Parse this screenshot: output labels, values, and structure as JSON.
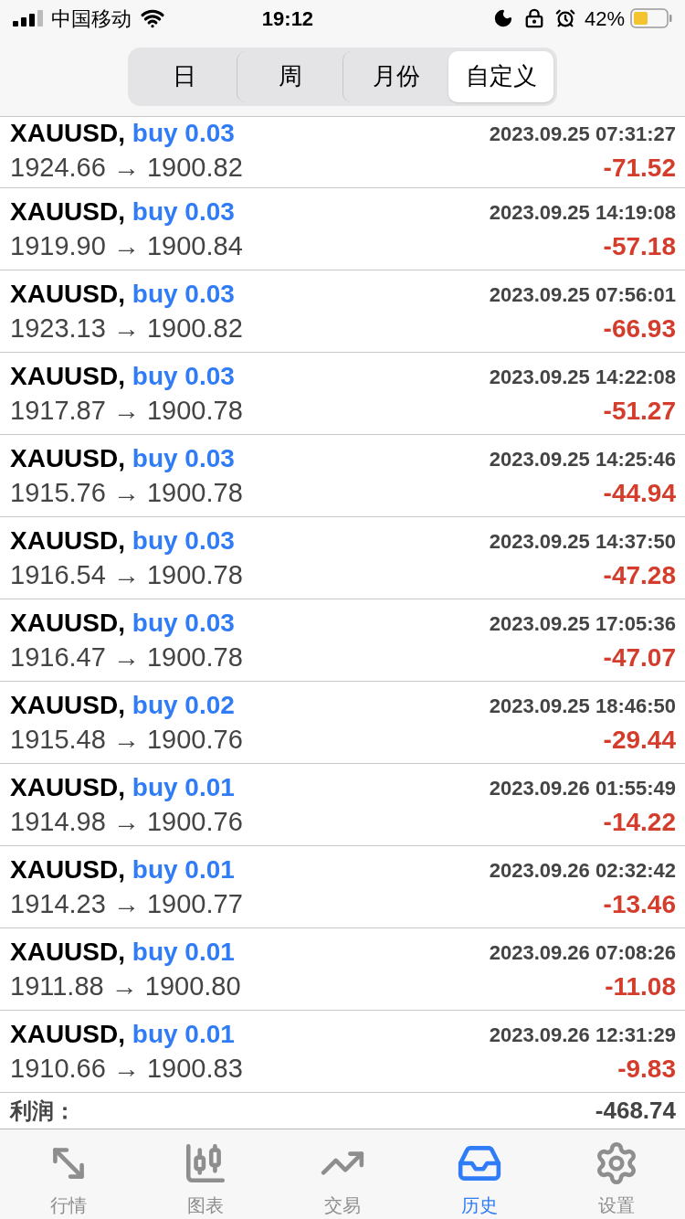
{
  "status_bar": {
    "carrier": "中国移动",
    "time": "19:12",
    "battery": "42%"
  },
  "period_tabs": [
    {
      "label": "日",
      "selected": false
    },
    {
      "label": "周",
      "selected": false
    },
    {
      "label": "月份",
      "selected": false
    },
    {
      "label": "自定义",
      "selected": true
    }
  ],
  "trades": [
    {
      "symbol": "XAUUSD,",
      "side": "buy 0.03",
      "time": "2023.09.25 07:31:27",
      "prices": "1924.66 → 1900.82",
      "profit": "-71.52"
    },
    {
      "symbol": "XAUUSD,",
      "side": "buy 0.03",
      "time": "2023.09.25 14:19:08",
      "prices": "1919.90 → 1900.84",
      "profit": "-57.18"
    },
    {
      "symbol": "XAUUSD,",
      "side": "buy 0.03",
      "time": "2023.09.25 07:56:01",
      "prices": "1923.13 → 1900.82",
      "profit": "-66.93"
    },
    {
      "symbol": "XAUUSD,",
      "side": "buy 0.03",
      "time": "2023.09.25 14:22:08",
      "prices": "1917.87 → 1900.78",
      "profit": "-51.27"
    },
    {
      "symbol": "XAUUSD,",
      "side": "buy 0.03",
      "time": "2023.09.25 14:25:46",
      "prices": "1915.76 → 1900.78",
      "profit": "-44.94"
    },
    {
      "symbol": "XAUUSD,",
      "side": "buy 0.03",
      "time": "2023.09.25 14:37:50",
      "prices": "1916.54 → 1900.78",
      "profit": "-47.28"
    },
    {
      "symbol": "XAUUSD,",
      "side": "buy 0.03",
      "time": "2023.09.25 17:05:36",
      "prices": "1916.47 → 1900.78",
      "profit": "-47.07"
    },
    {
      "symbol": "XAUUSD,",
      "side": "buy 0.02",
      "time": "2023.09.25 18:46:50",
      "prices": "1915.48 → 1900.76",
      "profit": "-29.44"
    },
    {
      "symbol": "XAUUSD,",
      "side": "buy 0.01",
      "time": "2023.09.26 01:55:49",
      "prices": "1914.98 → 1900.76",
      "profit": "-14.22"
    },
    {
      "symbol": "XAUUSD,",
      "side": "buy 0.01",
      "time": "2023.09.26 02:32:42",
      "prices": "1914.23 → 1900.77",
      "profit": "-13.46"
    },
    {
      "symbol": "XAUUSD,",
      "side": "buy 0.01",
      "time": "2023.09.26 07:08:26",
      "prices": "1911.88 → 1900.80",
      "profit": "-11.08"
    },
    {
      "symbol": "XAUUSD,",
      "side": "buy 0.01",
      "time": "2023.09.26 12:31:29",
      "prices": "1910.66 → 1900.83",
      "profit": "-9.83"
    }
  ],
  "summary": {
    "label": "利润：",
    "value": "-468.74"
  },
  "tab_bar": [
    {
      "kind": "quotes",
      "label": "行情",
      "selected": false
    },
    {
      "kind": "chart",
      "label": "图表",
      "selected": false
    },
    {
      "kind": "trade",
      "label": "交易",
      "selected": false
    },
    {
      "kind": "history",
      "label": "历史",
      "selected": true
    },
    {
      "kind": "settings",
      "label": "设置",
      "selected": false
    }
  ]
}
